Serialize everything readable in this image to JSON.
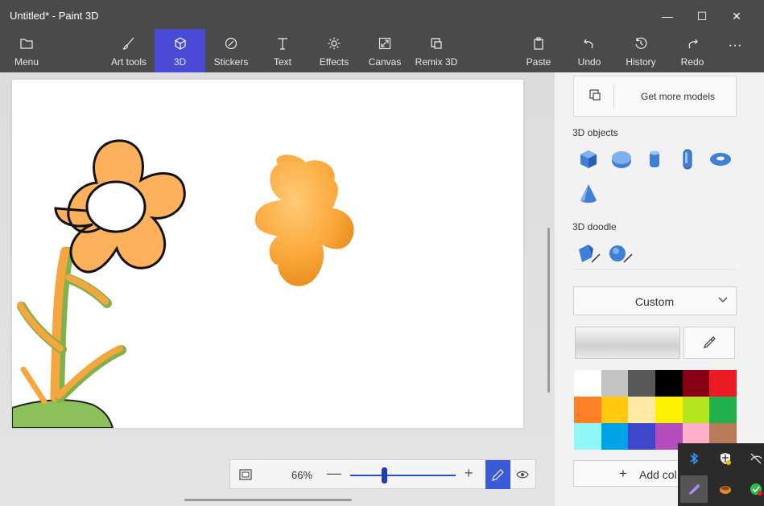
{
  "window": {
    "title": "Untitled* - Paint 3D",
    "minimize_glyph": "—",
    "maximize_glyph": "☐",
    "close_glyph": "✕"
  },
  "toolbar": {
    "menu": "Menu",
    "art_tools": "Art tools",
    "threed": "3D",
    "stickers": "Stickers",
    "text": "Text",
    "effects": "Effects",
    "canvas": "Canvas",
    "remix": "Remix 3D",
    "paste": "Paste",
    "undo": "Undo",
    "history": "History",
    "redo": "Redo",
    "more": "···",
    "active_tab": "3D"
  },
  "zoom": {
    "value": "66%",
    "minus": "—",
    "plus": "+"
  },
  "panel": {
    "get_more_models": "Get more models",
    "objects_label": "3D objects",
    "doodle_label": "3D doodle",
    "material": "Custom",
    "add_color": "Add col",
    "palette": [
      "#ffffff",
      "#c3c3c3",
      "#585858",
      "#000000",
      "#880015",
      "#ed1c24",
      "#ff7f27",
      "#ffc90e",
      "#ffeaa5",
      "#fff200",
      "#b5e61d",
      "#22b14c",
      "#8ff7f7",
      "#00a2e8",
      "#3f48cc",
      "#b44cbd",
      "#ffaec9",
      "#b97a57"
    ]
  },
  "colors": {
    "accent": "#4a4ad6",
    "flower_orange": "#fdb15d",
    "blob_orange": "#f9a93d",
    "stem_green": "#8bc05a"
  }
}
